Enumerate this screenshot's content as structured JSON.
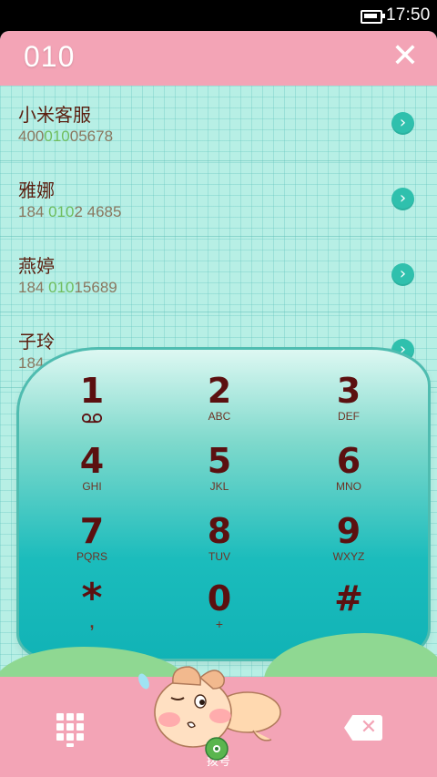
{
  "status_bar": {
    "time": "17:50"
  },
  "search": {
    "query": "010",
    "close_symbol": "✕"
  },
  "results": [
    {
      "name": "小米客服",
      "number_pre": "400",
      "number_hl": "010",
      "number_post": "05678"
    },
    {
      "name": "雅娜",
      "number_pre": "184 ",
      "number_hl": "010",
      "number_post": "2 4685"
    },
    {
      "name": "燕婷",
      "number_pre": "184 ",
      "number_hl": "010",
      "number_post": "15689"
    },
    {
      "name": "子玲",
      "number_pre": "184",
      "number_hl": "",
      "number_post": ""
    }
  ],
  "dialpad": {
    "keys": [
      {
        "digit": "1",
        "letters": ""
      },
      {
        "digit": "2",
        "letters": "ABC"
      },
      {
        "digit": "3",
        "letters": "DEF"
      },
      {
        "digit": "4",
        "letters": "GHI"
      },
      {
        "digit": "5",
        "letters": "JKL"
      },
      {
        "digit": "6",
        "letters": "MNO"
      },
      {
        "digit": "7",
        "letters": "PQRS"
      },
      {
        "digit": "8",
        "letters": "TUV"
      },
      {
        "digit": "9",
        "letters": "WXYZ"
      },
      {
        "digit": "*",
        "letters": ","
      },
      {
        "digit": "0",
        "letters": "+"
      },
      {
        "digit": "#",
        "letters": ""
      }
    ]
  },
  "bottom_bar": {
    "call_label": "拨号",
    "dialpad_toggle_icon": "dialpad-grid-icon",
    "backspace_icon": "backspace-icon",
    "call_icon": "mascot-call-icon"
  },
  "colors": {
    "pink": "#f3a4b6",
    "teal": "#1bbcbc",
    "digit": "#5b1010",
    "highlight": "#6fbd5e"
  }
}
